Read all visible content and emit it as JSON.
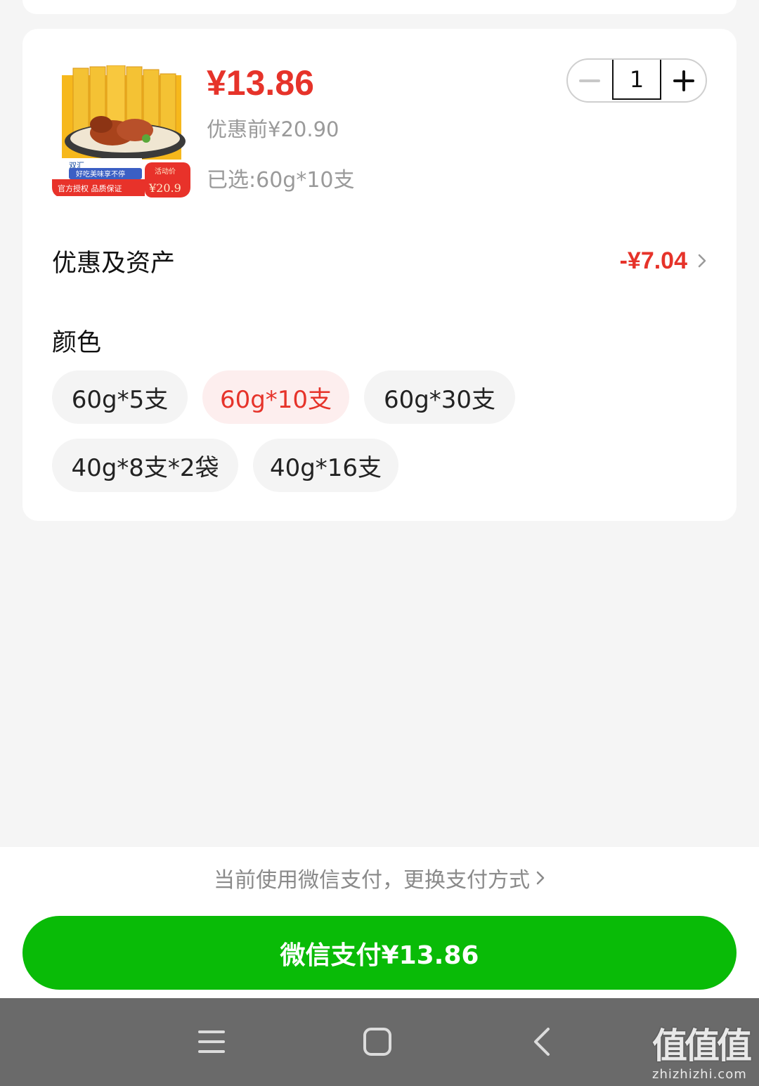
{
  "product": {
    "price": "¥13.86",
    "original_price": "优惠前¥20.90",
    "selected_spec": "已选:60g*10支",
    "thumbnail": {
      "brand_label": "双汇",
      "banner_text": "好吃美味享不停",
      "badge_text": "官方授权  品质保证",
      "promo_tag": "活动价",
      "promo_price": "¥20.9"
    }
  },
  "quantity": {
    "value": "1",
    "minus_label": "−",
    "plus_label": "+"
  },
  "discount": {
    "label": "优惠及资产",
    "value": "-¥7.04"
  },
  "options": {
    "title": "颜色",
    "items": [
      {
        "label": "60g*5支",
        "selected": false
      },
      {
        "label": "60g*10支",
        "selected": true
      },
      {
        "label": "60g*30支",
        "selected": false
      },
      {
        "label": "40g*8支*2袋",
        "selected": false
      },
      {
        "label": "40g*16支",
        "selected": false
      }
    ]
  },
  "payment": {
    "hint": "当前使用微信支付，更换支付方式",
    "button_label": "微信支付¥13.86"
  },
  "watermark": {
    "logo": "值值值",
    "url": "zhizhizhi.com"
  },
  "colors": {
    "accent_red": "#e6332a",
    "pay_green": "#09bb07",
    "nav_bg": "#6a6a6a"
  }
}
